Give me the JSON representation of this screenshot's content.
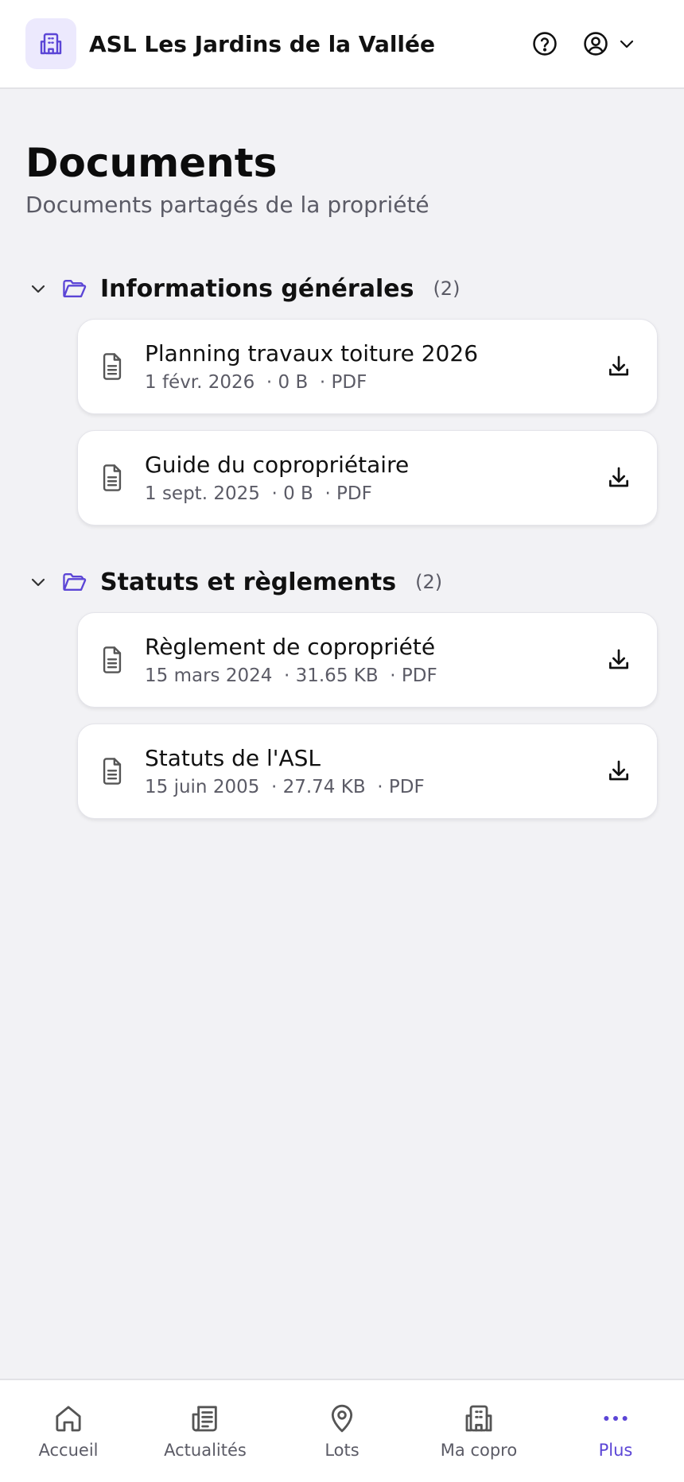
{
  "header": {
    "app_title": "ASL Les Jardins de la Vallée",
    "logo_icon": "building-icon",
    "help_icon": "help-circle-icon",
    "user_icon": "user-circle-icon",
    "menu_icon": "chevron-down-icon"
  },
  "page": {
    "title": "Documents",
    "subtitle": "Documents partagés de la propriété"
  },
  "sections": [
    {
      "title": "Informations générales",
      "count": "(2)",
      "documents": [
        {
          "name": "Planning travaux toiture 2026",
          "meta": "1 févr. 2026  · 0 B  · PDF"
        },
        {
          "name": "Guide du copropriétaire",
          "meta": "1 sept. 2025  · 0 B  · PDF"
        }
      ]
    },
    {
      "title": "Statuts et règlements",
      "count": "(2)",
      "documents": [
        {
          "name": "Règlement de copropriété",
          "meta": "15 mars 2024  · 31.65 KB  · PDF"
        },
        {
          "name": "Statuts de l'ASL",
          "meta": "15 juin 2005  · 27.74 KB  · PDF"
        }
      ]
    }
  ],
  "nav": {
    "items": [
      {
        "label": "Accueil",
        "icon": "home-icon"
      },
      {
        "label": "Actualités",
        "icon": "newspaper-icon"
      },
      {
        "label": "Lots",
        "icon": "map-pin-icon"
      },
      {
        "label": "Ma copro",
        "icon": "building-icon"
      },
      {
        "label": "Plus",
        "icon": "more-dots-icon"
      }
    ],
    "active": "Plus"
  },
  "colors": {
    "accent": "#5b45d6",
    "background": "#f2f2f5",
    "logo_bg": "#ece9fd"
  }
}
